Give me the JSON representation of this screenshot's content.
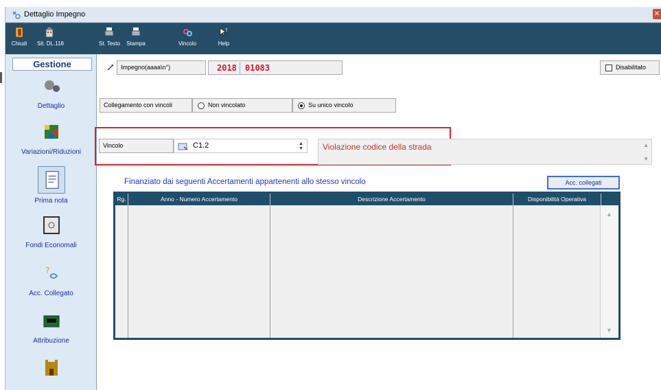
{
  "window": {
    "title": "Dettaglio Impegno",
    "close_label": "✕"
  },
  "toolbar": {
    "buttons": [
      {
        "label": "Chiudi",
        "icon": "door-exit-icon"
      },
      {
        "label": "Sit. DL.118",
        "icon": "building-icon"
      },
      {
        "label": "St. Testo",
        "icon": "printer-text-icon"
      },
      {
        "label": "Stampa",
        "icon": "printer-icon"
      },
      {
        "label": "Vincolo",
        "icon": "link-icon"
      },
      {
        "label": "Help",
        "icon": "help-arrow-icon"
      }
    ]
  },
  "sidebar": {
    "header": "Gestione",
    "items": [
      {
        "label": "Dettaglio",
        "icon": "magnifier-icon"
      },
      {
        "label": "Variazioni/Riduzioni",
        "icon": "rubik-cube-icon"
      },
      {
        "label": "Prima nota",
        "icon": "notepad-icon"
      },
      {
        "label": "Fondi Economali",
        "icon": "safe-icon"
      },
      {
        "label": "Acc. Collegato",
        "icon": "key-link-icon"
      },
      {
        "label": "Attribuzione",
        "icon": "cash-register-icon"
      },
      {
        "label": "",
        "icon": "castle-icon"
      }
    ]
  },
  "impegno": {
    "label": "Impegno(aaaa\\n°)",
    "year": "2018",
    "number": "01083"
  },
  "disabilitato": {
    "label": "Disabilitato",
    "checked": false
  },
  "collegamento": {
    "label": "Collegamento con vincoli",
    "option_none": "Non vincolato",
    "option_single": "Su unico vincolo",
    "selected": "Su unico vincolo"
  },
  "vincolo": {
    "label": "Vincolo",
    "value": "C1.2",
    "description": "Violazione codice della strada"
  },
  "finanziato": {
    "title": "Finanziato dai seguenti Accertamenti appartenenti allo stesso vincolo",
    "button_label": "Acc. collegati",
    "columns": [
      "Rg.",
      "Anno - Numero Accertamento",
      "Descrizione Accertamento",
      "Disponibilità Operativa"
    ],
    "rows": []
  },
  "colors": {
    "toolbar_bg": "#254d67",
    "sidebar_bg": "#dde9f4",
    "value_red": "#e0102d",
    "highlight_frame": "#e0202e",
    "link_blue": "#2233cc"
  }
}
